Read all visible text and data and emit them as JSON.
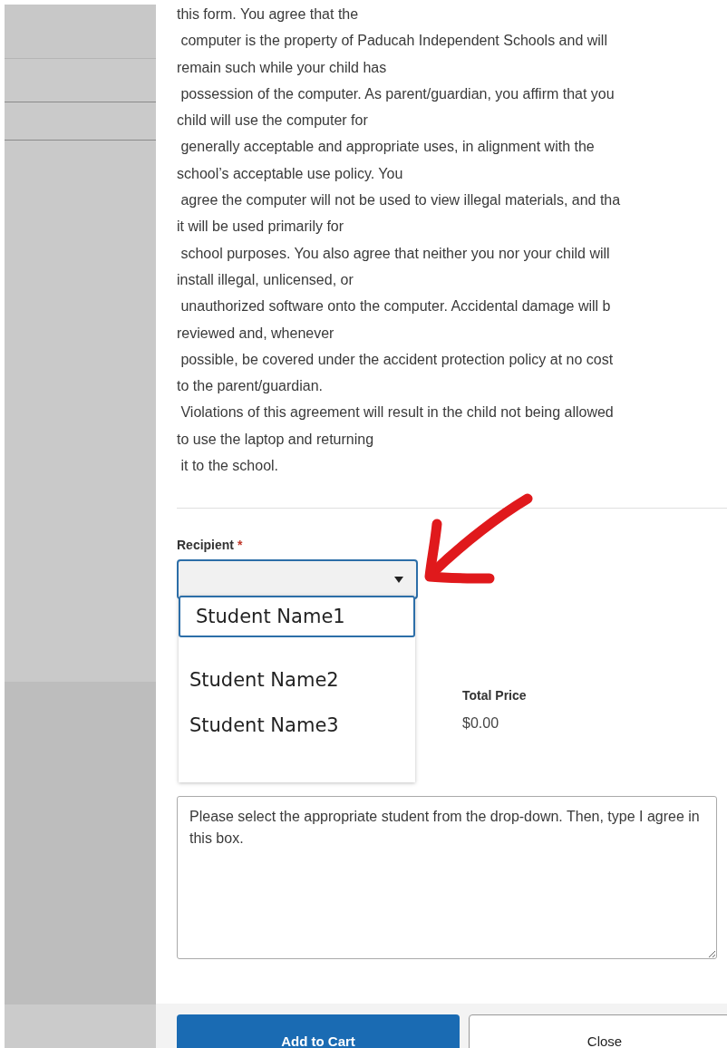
{
  "agreement_lines": [
    "this form. You agree that the",
    " computer is the property of Paducah Independent Schools and will",
    "remain such while your child has",
    " possession of the computer. As parent/guardian, you affirm that you",
    "child will use the computer for",
    " generally acceptable and appropriate uses, in alignment with the",
    "school’s acceptable use policy. You",
    " agree the computer will not be used to view illegal materials, and tha",
    "it will be used primarily for",
    " school purposes. You also agree that neither you nor your child will",
    "install illegal, unlicensed, or",
    " unauthorized software onto the computer. Accidental damage will b",
    "reviewed and, whenever",
    " possible, be covered under the accident protection policy at no cost",
    "to the parent/guardian.",
    " Violations of this agreement will result in the child not being allowed",
    "to use the laptop and returning",
    " it to the school."
  ],
  "recipient": {
    "label": "Recipient",
    "required_mark": "*",
    "expanded": true,
    "options": [
      {
        "label": "Student Name1",
        "selected": true
      },
      {
        "label": "Student Name2",
        "selected": false
      },
      {
        "label": "Student Name3",
        "selected": false
      }
    ]
  },
  "total_price": {
    "label": "Total Price",
    "value": "$0.00"
  },
  "comments": {
    "value": "Please select the appropriate student from the drop-down. Then, type I agree in this box."
  },
  "buttons": [
    {
      "kind": "primary",
      "label": "Add to Cart"
    },
    {
      "kind": "secondary",
      "label": "Close"
    }
  ]
}
